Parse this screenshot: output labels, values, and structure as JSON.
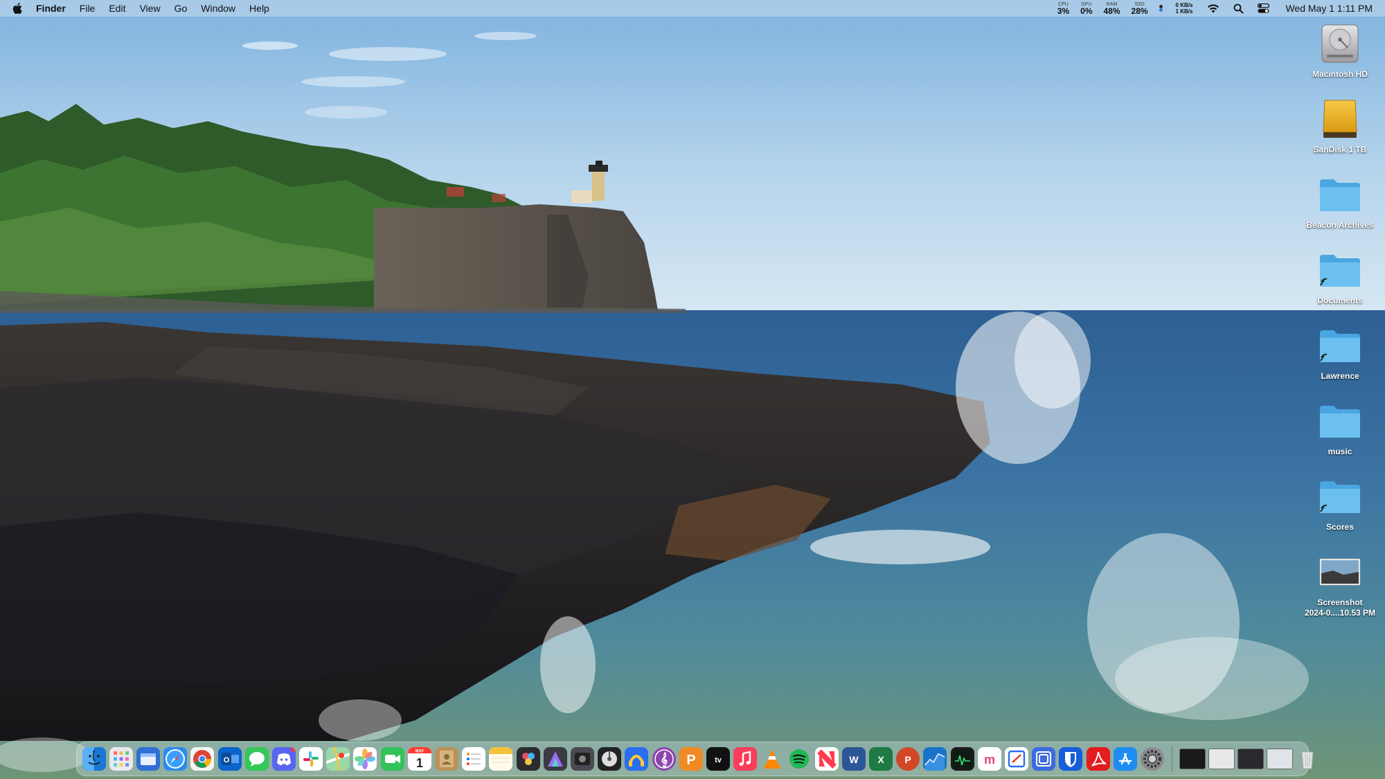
{
  "menubar": {
    "app_name": "Finder",
    "menus": [
      "File",
      "Edit",
      "View",
      "Go",
      "Window",
      "Help"
    ],
    "stats": [
      {
        "label": "CPU",
        "value": "3%"
      },
      {
        "label": "GPU",
        "value": "0%"
      },
      {
        "label": "RAM",
        "value": "48%"
      },
      {
        "label": "SSD",
        "value": "28%"
      }
    ],
    "net_up": "0 KB/s",
    "net_down": "1 KB/s",
    "clock": "Wed May 1  1:11 PM",
    "icons": [
      "wifi-icon",
      "search-icon",
      "control-center-icon"
    ]
  },
  "desktop": {
    "items": [
      {
        "label": "Macintosh HD",
        "icon": "hard-drive-icon"
      },
      {
        "label": "SanDisk 1 TB",
        "icon": "external-drive-icon"
      },
      {
        "label": "Beacon Archives",
        "icon": "folder-icon"
      },
      {
        "label": "Documents",
        "icon": "folder-alias-icon"
      },
      {
        "label": "Lawrence",
        "icon": "folder-alias-icon"
      },
      {
        "label": "music",
        "icon": "folder-icon"
      },
      {
        "label": "Scores",
        "icon": "folder-alias-icon"
      },
      {
        "label": "Screenshot\n2024-0....10.53 PM",
        "icon": "screenshot-thumbnail-icon"
      }
    ]
  },
  "dock": {
    "apps": [
      {
        "name": "finder-icon",
        "color": "#1e88e5",
        "running": true
      },
      {
        "name": "launchpad-icon",
        "color": "#e9e9ee",
        "running": false
      },
      {
        "name": "files-icon",
        "color": "#2f6fd6",
        "running": false
      },
      {
        "name": "safari-icon",
        "color": "#2a8bf2",
        "running": true
      },
      {
        "name": "chrome-icon",
        "color": "#f4f4f4",
        "running": true
      },
      {
        "name": "outlook-icon",
        "color": "#0a64c9",
        "running": false
      },
      {
        "name": "messages-icon",
        "color": "#34c759",
        "running": false
      },
      {
        "name": "discord-icon",
        "color": "#5865f2",
        "running": true
      },
      {
        "name": "slack-icon",
        "color": "#ffffff",
        "running": false
      },
      {
        "name": "maps-icon",
        "color": "#5ac37a",
        "running": false
      },
      {
        "name": "photos-icon",
        "color": "#ffffff",
        "running": false
      },
      {
        "name": "facetime-icon",
        "color": "#32c25a",
        "running": false
      },
      {
        "name": "calendar-icon",
        "color": "#ffffff",
        "running": false
      },
      {
        "name": "contacts-icon",
        "color": "#b8925a",
        "running": false
      },
      {
        "name": "reminders-icon",
        "color": "#ffffff",
        "running": false
      },
      {
        "name": "notes-icon",
        "color": "#fbe26b",
        "running": false
      },
      {
        "name": "davinci-resolve-icon",
        "color": "#2b2b30",
        "running": false
      },
      {
        "name": "affinity-icon",
        "color": "#3a3a44",
        "running": false
      },
      {
        "name": "screenflow-icon",
        "color": "#4a4a52",
        "running": false
      },
      {
        "name": "disk-utility-icon",
        "color": "#222226",
        "running": false
      },
      {
        "name": "audio-app-icon",
        "color": "#ff9f1c",
        "running": false
      },
      {
        "name": "music-app-icon",
        "color": "#8e44ad",
        "running": false
      },
      {
        "name": "pdf-app-icon",
        "color": "#f08a24",
        "running": false
      },
      {
        "name": "apple-tv-icon",
        "color": "#111111",
        "running": false
      },
      {
        "name": "apple-music-icon",
        "color": "#fa3d5a",
        "running": false
      },
      {
        "name": "vlc-icon",
        "color": "#ffffff",
        "running": false
      },
      {
        "name": "spotify-icon",
        "color": "#1db954",
        "running": false
      },
      {
        "name": "news-icon",
        "color": "#ff3b4d",
        "running": false
      },
      {
        "name": "word-icon",
        "color": "#2b5797",
        "running": false
      },
      {
        "name": "excel-icon",
        "color": "#1f7a45",
        "running": false
      },
      {
        "name": "powerpoint-icon",
        "color": "#d24726",
        "running": false
      },
      {
        "name": "stocks-icon",
        "color": "#1a73c9",
        "running": true
      },
      {
        "name": "activity-monitor-icon",
        "color": "#1b1b1b",
        "running": false
      },
      {
        "name": "mimestream-icon",
        "color": "#ffffff",
        "running": false
      },
      {
        "name": "sync-app-icon",
        "color": "#ffffff",
        "running": false
      },
      {
        "name": "vpn-app-icon",
        "color": "#3c6be0",
        "running": false
      },
      {
        "name": "bitwarden-icon",
        "color": "#175ddc",
        "running": false
      },
      {
        "name": "acrobat-icon",
        "color": "#e31d1d",
        "running": false
      },
      {
        "name": "app-store-icon",
        "color": "#1e8cf0",
        "running": false
      },
      {
        "name": "system-settings-icon",
        "color": "#8a8a90",
        "running": false
      }
    ],
    "minimized_windows": 4
  }
}
